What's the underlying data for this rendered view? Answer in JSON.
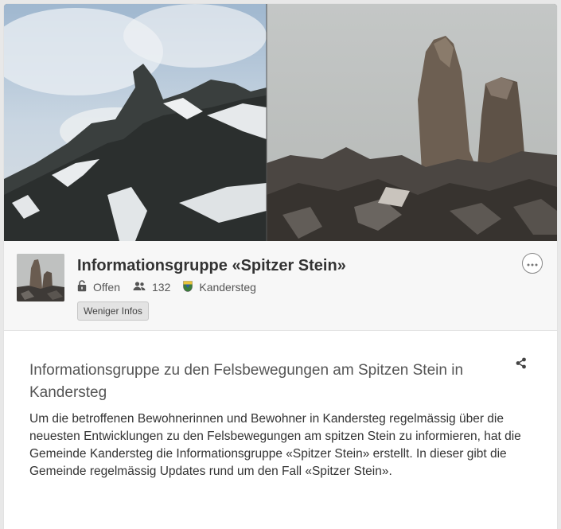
{
  "group": {
    "title": "Informationsgruppe «Spitzer Stein»",
    "status": "Offen",
    "member_count": "132",
    "location": "Kandersteg",
    "less_info_button": "Weniger Infos"
  },
  "icons": {
    "status": "unlock-icon",
    "members": "users-icon",
    "location": "coat-of-arms-icon",
    "more": "more-options-icon",
    "share": "share-icon"
  },
  "description": {
    "title": "Informationsgruppe zu den Felsbewegungen am Spitzen Stein in Kandersteg",
    "text": "Um die betroffenen Bewohnerinnen und Bewohner in Kandersteg regelmässig über die neuesten Entwicklungen zu den Felsbewegungen am spitzen Stein zu informieren, hat die Gemeinde Kandersteg die Informationsgruppe «Spitzer Stein» erstellt. In dieser gibt die Gemeinde regelmässig Updates rund um den Fall «Spitzer Stein»."
  },
  "colors": {
    "header_bg": "#f7f7f7",
    "button_bg": "#e3e3e3"
  }
}
